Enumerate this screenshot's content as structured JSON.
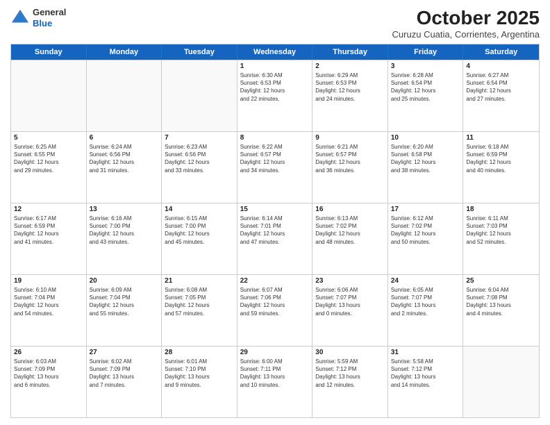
{
  "logo": {
    "general": "General",
    "blue": "Blue"
  },
  "title": "October 2025",
  "subtitle": "Curuzu Cuatia, Corrientes, Argentina",
  "days": [
    "Sunday",
    "Monday",
    "Tuesday",
    "Wednesday",
    "Thursday",
    "Friday",
    "Saturday"
  ],
  "weeks": [
    [
      {
        "date": "",
        "info": ""
      },
      {
        "date": "",
        "info": ""
      },
      {
        "date": "",
        "info": ""
      },
      {
        "date": "1",
        "info": "Sunrise: 6:30 AM\nSunset: 6:53 PM\nDaylight: 12 hours\nand 22 minutes."
      },
      {
        "date": "2",
        "info": "Sunrise: 6:29 AM\nSunset: 6:53 PM\nDaylight: 12 hours\nand 24 minutes."
      },
      {
        "date": "3",
        "info": "Sunrise: 6:28 AM\nSunset: 6:54 PM\nDaylight: 12 hours\nand 25 minutes."
      },
      {
        "date": "4",
        "info": "Sunrise: 6:27 AM\nSunset: 6:54 PM\nDaylight: 12 hours\nand 27 minutes."
      }
    ],
    [
      {
        "date": "5",
        "info": "Sunrise: 6:25 AM\nSunset: 6:55 PM\nDaylight: 12 hours\nand 29 minutes."
      },
      {
        "date": "6",
        "info": "Sunrise: 6:24 AM\nSunset: 6:56 PM\nDaylight: 12 hours\nand 31 minutes."
      },
      {
        "date": "7",
        "info": "Sunrise: 6:23 AM\nSunset: 6:56 PM\nDaylight: 12 hours\nand 33 minutes."
      },
      {
        "date": "8",
        "info": "Sunrise: 6:22 AM\nSunset: 6:57 PM\nDaylight: 12 hours\nand 34 minutes."
      },
      {
        "date": "9",
        "info": "Sunrise: 6:21 AM\nSunset: 6:57 PM\nDaylight: 12 hours\nand 36 minutes."
      },
      {
        "date": "10",
        "info": "Sunrise: 6:20 AM\nSunset: 6:58 PM\nDaylight: 12 hours\nand 38 minutes."
      },
      {
        "date": "11",
        "info": "Sunrise: 6:18 AM\nSunset: 6:59 PM\nDaylight: 12 hours\nand 40 minutes."
      }
    ],
    [
      {
        "date": "12",
        "info": "Sunrise: 6:17 AM\nSunset: 6:59 PM\nDaylight: 12 hours\nand 41 minutes."
      },
      {
        "date": "13",
        "info": "Sunrise: 6:16 AM\nSunset: 7:00 PM\nDaylight: 12 hours\nand 43 minutes."
      },
      {
        "date": "14",
        "info": "Sunrise: 6:15 AM\nSunset: 7:00 PM\nDaylight: 12 hours\nand 45 minutes."
      },
      {
        "date": "15",
        "info": "Sunrise: 6:14 AM\nSunset: 7:01 PM\nDaylight: 12 hours\nand 47 minutes."
      },
      {
        "date": "16",
        "info": "Sunrise: 6:13 AM\nSunset: 7:02 PM\nDaylight: 12 hours\nand 48 minutes."
      },
      {
        "date": "17",
        "info": "Sunrise: 6:12 AM\nSunset: 7:02 PM\nDaylight: 12 hours\nand 50 minutes."
      },
      {
        "date": "18",
        "info": "Sunrise: 6:11 AM\nSunset: 7:03 PM\nDaylight: 12 hours\nand 52 minutes."
      }
    ],
    [
      {
        "date": "19",
        "info": "Sunrise: 6:10 AM\nSunset: 7:04 PM\nDaylight: 12 hours\nand 54 minutes."
      },
      {
        "date": "20",
        "info": "Sunrise: 6:09 AM\nSunset: 7:04 PM\nDaylight: 12 hours\nand 55 minutes."
      },
      {
        "date": "21",
        "info": "Sunrise: 6:08 AM\nSunset: 7:05 PM\nDaylight: 12 hours\nand 57 minutes."
      },
      {
        "date": "22",
        "info": "Sunrise: 6:07 AM\nSunset: 7:06 PM\nDaylight: 12 hours\nand 59 minutes."
      },
      {
        "date": "23",
        "info": "Sunrise: 6:06 AM\nSunset: 7:07 PM\nDaylight: 13 hours\nand 0 minutes."
      },
      {
        "date": "24",
        "info": "Sunrise: 6:05 AM\nSunset: 7:07 PM\nDaylight: 13 hours\nand 2 minutes."
      },
      {
        "date": "25",
        "info": "Sunrise: 6:04 AM\nSunset: 7:08 PM\nDaylight: 13 hours\nand 4 minutes."
      }
    ],
    [
      {
        "date": "26",
        "info": "Sunrise: 6:03 AM\nSunset: 7:09 PM\nDaylight: 13 hours\nand 6 minutes."
      },
      {
        "date": "27",
        "info": "Sunrise: 6:02 AM\nSunset: 7:09 PM\nDaylight: 13 hours\nand 7 minutes."
      },
      {
        "date": "28",
        "info": "Sunrise: 6:01 AM\nSunset: 7:10 PM\nDaylight: 13 hours\nand 9 minutes."
      },
      {
        "date": "29",
        "info": "Sunrise: 6:00 AM\nSunset: 7:11 PM\nDaylight: 13 hours\nand 10 minutes."
      },
      {
        "date": "30",
        "info": "Sunrise: 5:59 AM\nSunset: 7:12 PM\nDaylight: 13 hours\nand 12 minutes."
      },
      {
        "date": "31",
        "info": "Sunrise: 5:58 AM\nSunset: 7:12 PM\nDaylight: 13 hours\nand 14 minutes."
      },
      {
        "date": "",
        "info": ""
      }
    ]
  ]
}
